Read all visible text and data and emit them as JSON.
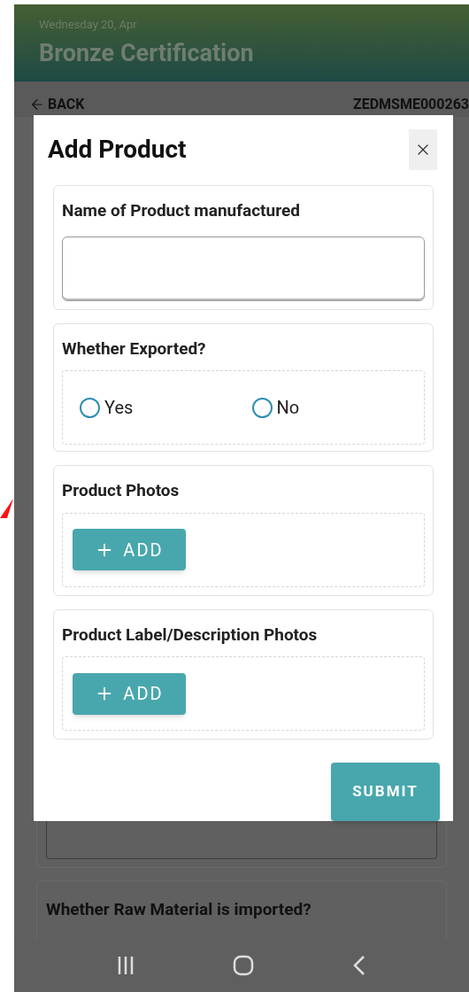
{
  "header": {
    "date": "Wednesday 20, Apr",
    "title": "Bronze Certification"
  },
  "nav": {
    "back": "BACK",
    "id": "ZEDMSME000263"
  },
  "background_form": {
    "question": "Whether Raw Material is imported?"
  },
  "dialog": {
    "title": "Add Product",
    "fields": [
      {
        "kind": "text",
        "label": "Name of Product manufactured"
      },
      {
        "kind": "radio",
        "label": "Whether Exported?",
        "options": [
          {
            "label": "Yes",
            "selected": false
          },
          {
            "label": "No",
            "selected": false
          }
        ]
      },
      {
        "kind": "upload",
        "label": "Product Photos",
        "button": "ADD"
      },
      {
        "kind": "upload",
        "label": "Product Label/Description Photos",
        "button": "ADD"
      }
    ],
    "submit": "SUBMIT"
  }
}
